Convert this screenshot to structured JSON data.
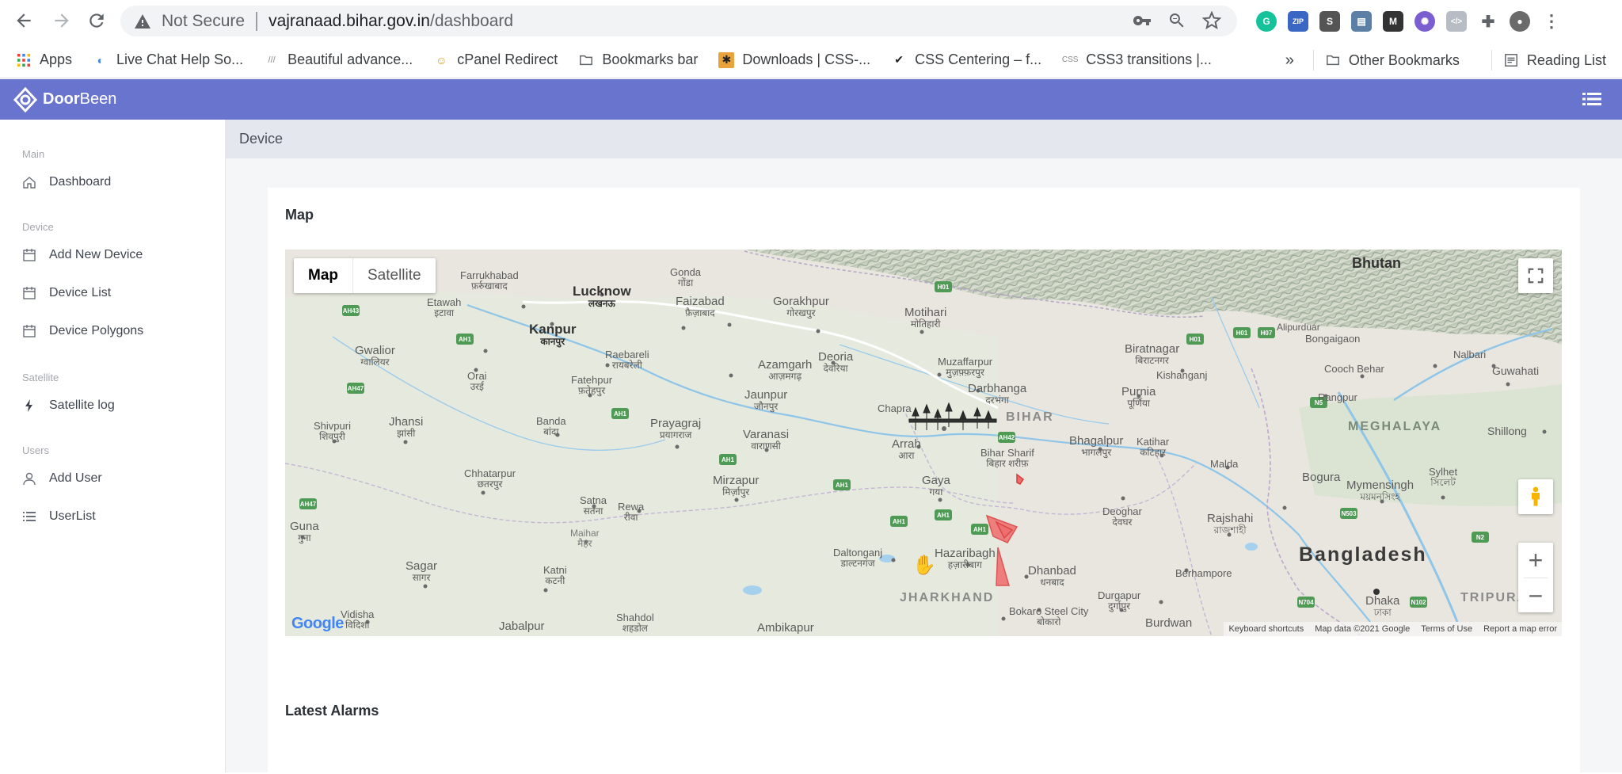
{
  "browser": {
    "not_secure": "Not Secure",
    "url_host": "vajranaad.bihar.gov.in",
    "url_path": "/dashboard",
    "extensions": [
      "grammarly-icon",
      "zip-icon",
      "s-icon",
      "printer-icon",
      "m-icon",
      "gear-purple-icon",
      "code-icon",
      "puzzle-icon",
      "avatar"
    ]
  },
  "bookmarks": {
    "items": [
      {
        "label": "Apps",
        "icon": "apps-grid-icon"
      },
      {
        "label": "Live Chat Help So...",
        "icon": "chat-icon"
      },
      {
        "label": "Beautiful advance...",
        "icon": "site-icon"
      },
      {
        "label": "cPanel Redirect",
        "icon": "cpanel-icon"
      },
      {
        "label": "Bookmarks bar",
        "icon": "folder-icon"
      },
      {
        "label": "Downloads | CSS-...",
        "icon": "css-tricks-icon"
      },
      {
        "label": "CSS Centering – f...",
        "icon": "w3-icon"
      },
      {
        "label": "CSS3 transitions |...",
        "icon": "css3-icon"
      }
    ],
    "overflow": "»",
    "other_bookmarks": "Other Bookmarks",
    "reading_list": "Reading List"
  },
  "app": {
    "brand_prefix": "Door",
    "brand_suffix": "Been",
    "header_color": "#6974cf"
  },
  "sidebar": {
    "sections": [
      {
        "title": "Main",
        "items": [
          {
            "label": "Dashboard",
            "icon": "home-icon"
          }
        ]
      },
      {
        "title": "Device",
        "items": [
          {
            "label": "Add New Device",
            "icon": "calendar-icon"
          },
          {
            "label": "Device List",
            "icon": "calendar-icon"
          },
          {
            "label": "Device Polygons",
            "icon": "calendar-icon"
          }
        ]
      },
      {
        "title": "Satellite",
        "items": [
          {
            "label": "Satellite log",
            "icon": "bolt-icon"
          }
        ]
      },
      {
        "title": "Users",
        "items": [
          {
            "label": "Add User",
            "icon": "user-icon"
          },
          {
            "label": "UserList",
            "icon": "list-icon"
          }
        ]
      }
    ]
  },
  "main": {
    "page_title": "Device",
    "map_card_title": "Map",
    "alarms_card_title": "Latest Alarms"
  },
  "map": {
    "type_map": "Map",
    "type_satellite": "Satellite",
    "zoom_in": "+",
    "zoom_out": "−",
    "footer": [
      "Keyboard shortcuts",
      "Map data ©2021 Google",
      "Terms of Use",
      "Report a map error"
    ],
    "google": "Google",
    "labels": [
      {
        "name": "Bhutan"
      },
      {
        "name": "Lucknow",
        "sub": "लखनऊ"
      },
      {
        "name": "Kanpur",
        "sub": "कानपुर"
      },
      {
        "name": "Farrukhabad",
        "sub": "फ़र्रुखाबाद"
      },
      {
        "name": "Etawah",
        "sub": "इटावा"
      },
      {
        "name": "Gonda",
        "sub": "गोंडा"
      },
      {
        "name": "Faizabad",
        "sub": "फ़ैज़ाबाद"
      },
      {
        "name": "Gorakhpur",
        "sub": "गोरखपुर"
      },
      {
        "name": "Motihari",
        "sub": "मोतिहारी"
      },
      {
        "name": "Gwalior",
        "sub": "ग्वालियर"
      },
      {
        "name": "Orai",
        "sub": "उरई"
      },
      {
        "name": "Raebareli",
        "sub": "रायबरेली"
      },
      {
        "name": "Fatehpur",
        "sub": "फ़तेहपुर"
      },
      {
        "name": "Azamgarh",
        "sub": "आज़मगढ़"
      },
      {
        "name": "Deoria",
        "sub": "देवरिया"
      },
      {
        "name": "Muzaffarpur",
        "sub": "मुज़फ़्फ़रपुर"
      },
      {
        "name": "Darbhanga",
        "sub": "दरभंगा"
      },
      {
        "name": "Jaunpur",
        "sub": "जौनपुर"
      },
      {
        "name": "Chapra"
      },
      {
        "name": "BIHAR"
      },
      {
        "name": "Purnia",
        "sub": "पूर्णिया"
      },
      {
        "name": "Kishanganj"
      },
      {
        "name": "Biratnagar",
        "sub": "बिराटनगर"
      },
      {
        "name": "Jhansi",
        "sub": "झांसी"
      },
      {
        "name": "Shivpuri",
        "sub": "शिवपुरी"
      },
      {
        "name": "Banda",
        "sub": "बांदा"
      },
      {
        "name": "Prayagraj",
        "sub": "प्रयागराज"
      },
      {
        "name": "Varanasi",
        "sub": "वाराणसी"
      },
      {
        "name": "Arrah",
        "sub": "आरा"
      },
      {
        "name": "Bhagalpur",
        "sub": "भागलपुर"
      },
      {
        "name": "Katihar",
        "sub": "कटिहार"
      },
      {
        "name": "Malda"
      },
      {
        "name": "Bihar Sharif",
        "sub": "बिहार शरीफ़"
      },
      {
        "name": "Chhatarpur",
        "sub": "छतरपुर"
      },
      {
        "name": "Mirzapur",
        "sub": "मिर्ज़ापुर"
      },
      {
        "name": "Gaya",
        "sub": "गया"
      },
      {
        "name": "Satna",
        "sub": "सतना"
      },
      {
        "name": "Rewa",
        "sub": "रीवा"
      },
      {
        "name": "Deoghar",
        "sub": "देवघर"
      },
      {
        "name": "Bogura"
      },
      {
        "name": "Mymensingh",
        "sub": "ময়মনসিংহ"
      },
      {
        "name": "Sylhet",
        "sub": "সিলেট"
      },
      {
        "name": "Rajshahi",
        "sub": "রাজশাহী"
      },
      {
        "name": "Guna",
        "sub": "गुना"
      },
      {
        "name": "Maihar",
        "sub": "मैहर"
      },
      {
        "name": "Daltonganj",
        "sub": "डाल्टनगंज"
      },
      {
        "name": "Hazaribagh",
        "sub": "हज़ारीबाग"
      },
      {
        "name": "Dhanbad",
        "sub": "धनबाद"
      },
      {
        "name": "Berhampore"
      },
      {
        "name": "Bangladesh"
      },
      {
        "name": "Sagar",
        "sub": "सागर"
      },
      {
        "name": "Katni",
        "sub": "कटनी"
      },
      {
        "name": "JHARKHAND"
      },
      {
        "name": "Durgapur",
        "sub": "दुर्गापुर"
      },
      {
        "name": "Dhaka",
        "sub": "ঢাকা"
      },
      {
        "name": "Jabalpur"
      },
      {
        "name": "Shahdol",
        "sub": "शहडोल"
      },
      {
        "name": "Ambikapur"
      },
      {
        "name": "Bokaro Steel City",
        "sub": "बोकारो"
      },
      {
        "name": "Burdwan"
      },
      {
        "name": "Vidisha",
        "sub": "विदिशा"
      },
      {
        "name": "MEGHALAYA"
      },
      {
        "name": "Shillong"
      },
      {
        "name": "Guwahati"
      },
      {
        "name": "Bongaigaon"
      },
      {
        "name": "Nalbari"
      },
      {
        "name": "Cooch Behar"
      },
      {
        "name": "Rangpur"
      },
      {
        "name": "TRIPURA"
      },
      {
        "name": "Alipurduar"
      }
    ]
  }
}
